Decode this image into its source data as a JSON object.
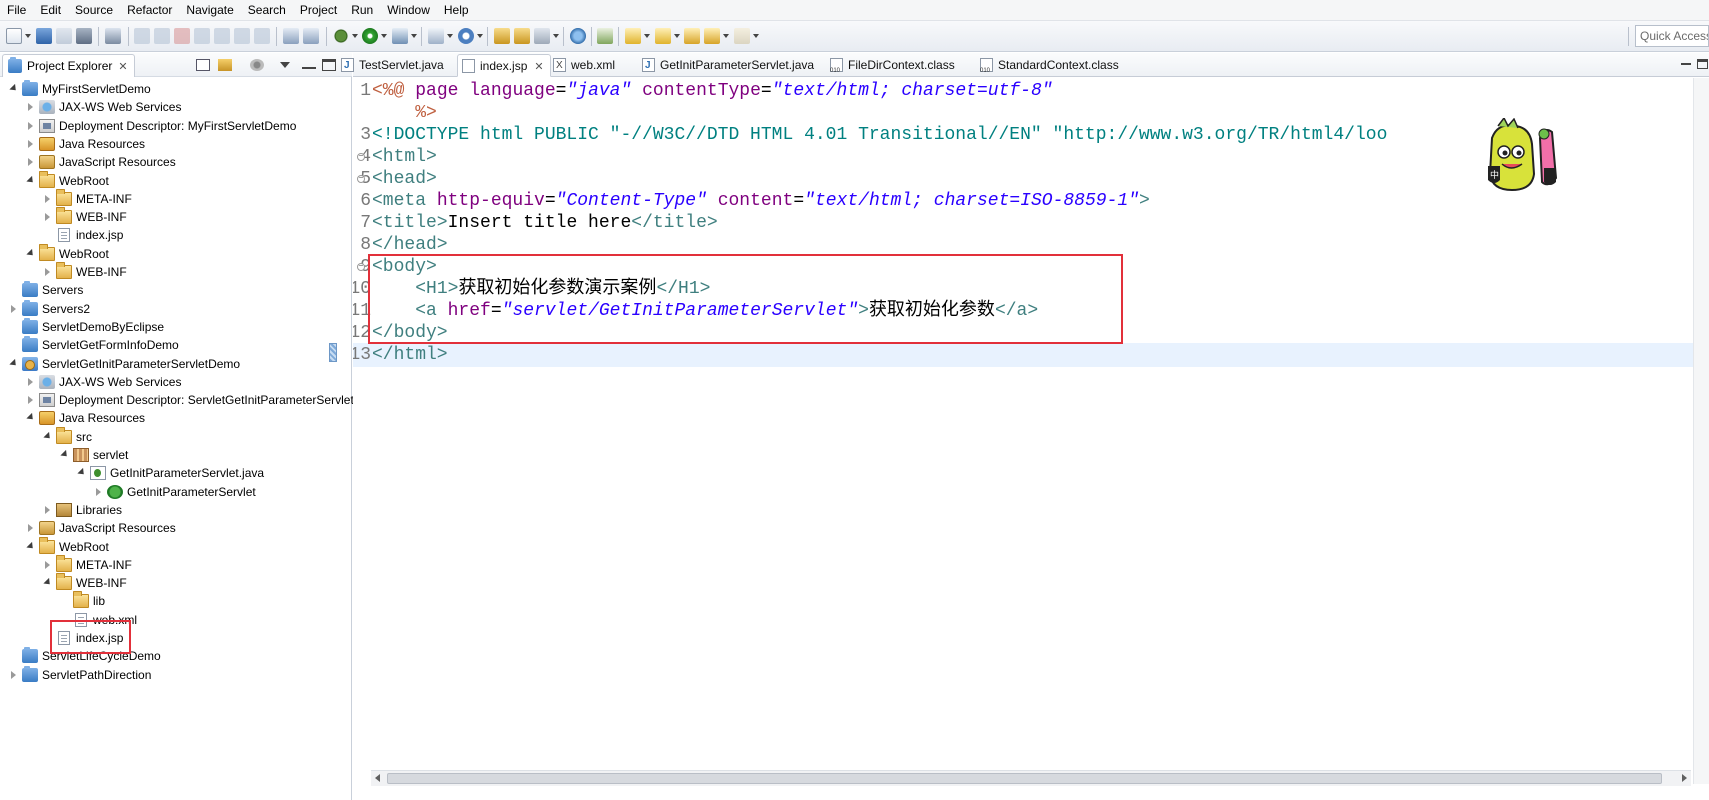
{
  "menu": [
    "File",
    "Edit",
    "Source",
    "Refactor",
    "Navigate",
    "Search",
    "Project",
    "Run",
    "Window",
    "Help"
  ],
  "quick_access": "Quick Access",
  "project_explorer": {
    "title": "Project Explorer",
    "tree": [
      {
        "label": "MyFirstServletDemo",
        "icon": "project-icon",
        "depth": 0,
        "expanded": true
      },
      {
        "label": "JAX-WS Web Services",
        "icon": "jax-ws-icon",
        "depth": 1,
        "expanded": false
      },
      {
        "label": "Deployment Descriptor: MyFirstServletDemo",
        "icon": "deployment-descriptor-icon",
        "depth": 1,
        "expanded": false
      },
      {
        "label": "Java Resources",
        "icon": "java-resources-icon",
        "depth": 1,
        "expanded": false
      },
      {
        "label": "JavaScript Resources",
        "icon": "javascript-resources-icon",
        "depth": 1,
        "expanded": false
      },
      {
        "label": "WebRoot",
        "icon": "folder-icon",
        "depth": 1,
        "expanded": true
      },
      {
        "label": "META-INF",
        "icon": "folder-icon",
        "depth": 2,
        "expanded": false
      },
      {
        "label": "WEB-INF",
        "icon": "folder-icon",
        "depth": 2,
        "expanded": false
      },
      {
        "label": "index.jsp",
        "icon": "file-icon",
        "depth": 2,
        "expanded": null
      },
      {
        "label": "WebRoot",
        "icon": "folder-icon",
        "depth": 1,
        "expanded": true
      },
      {
        "label": "WEB-INF",
        "icon": "folder-icon",
        "depth": 2,
        "expanded": false
      },
      {
        "label": "Servers",
        "icon": "project-icon",
        "depth": 0,
        "expanded": null
      },
      {
        "label": "Servers2",
        "icon": "project-icon",
        "depth": 0,
        "expanded": false
      },
      {
        "label": "ServletDemoByEclipse",
        "icon": "project-icon",
        "depth": 0,
        "expanded": null
      },
      {
        "label": "ServletGetFormInfoDemo",
        "icon": "project-icon",
        "depth": 0,
        "expanded": null
      },
      {
        "label": "ServletGetInitParameterServletDemo",
        "icon": "web-project-icon",
        "depth": 0,
        "expanded": true
      },
      {
        "label": "JAX-WS Web Services",
        "icon": "jax-ws-icon",
        "depth": 1,
        "expanded": false
      },
      {
        "label": "Deployment Descriptor: ServletGetInitParameterServletDemo",
        "icon": "deployment-descriptor-icon",
        "depth": 1,
        "expanded": false
      },
      {
        "label": "Java Resources",
        "icon": "java-resources-icon",
        "depth": 1,
        "expanded": true
      },
      {
        "label": "src",
        "icon": "source-folder-icon",
        "depth": 2,
        "expanded": true
      },
      {
        "label": "servlet",
        "icon": "package-icon",
        "depth": 3,
        "expanded": true
      },
      {
        "label": "GetInitParameterServlet.java",
        "icon": "java-file-icon",
        "depth": 4,
        "expanded": true
      },
      {
        "label": "GetInitParameterServlet",
        "icon": "class-icon",
        "depth": 5,
        "expanded": false
      },
      {
        "label": "Libraries",
        "icon": "library-icon",
        "depth": 2,
        "expanded": false
      },
      {
        "label": "JavaScript Resources",
        "icon": "javascript-resources-icon",
        "depth": 1,
        "expanded": false
      },
      {
        "label": "WebRoot",
        "icon": "folder-icon",
        "depth": 1,
        "expanded": true
      },
      {
        "label": "META-INF",
        "icon": "folder-icon",
        "depth": 2,
        "expanded": false
      },
      {
        "label": "WEB-INF",
        "icon": "folder-icon",
        "depth": 2,
        "expanded": true
      },
      {
        "label": "lib",
        "icon": "folder-icon",
        "depth": 3,
        "expanded": null
      },
      {
        "label": "web.xml",
        "icon": "xml-file-icon",
        "depth": 3,
        "expanded": null
      },
      {
        "label": "index.jsp",
        "icon": "file-icon",
        "depth": 2,
        "expanded": null
      },
      {
        "label": "ServletLifeCycleDemo",
        "icon": "project-icon",
        "depth": 0,
        "expanded": null
      },
      {
        "label": "ServletPathDirection",
        "icon": "project-icon",
        "depth": 0,
        "expanded": false
      }
    ]
  },
  "editor": {
    "tabs": [
      {
        "label": "TestServlet.java",
        "icon": "java-file-icon",
        "active": false
      },
      {
        "label": "index.jsp",
        "icon": "jsp-file-icon",
        "active": true
      },
      {
        "label": "web.xml",
        "icon": "xml-file-icon",
        "active": false
      },
      {
        "label": "GetInitParameterServlet.java",
        "icon": "java-file-icon",
        "active": false
      },
      {
        "label": "FileDirContext.class",
        "icon": "class-file-icon",
        "active": false
      },
      {
        "label": "StandardContext.class",
        "icon": "class-file-icon",
        "active": false
      }
    ],
    "lines": [
      {
        "num": "1",
        "fold": false,
        "segments": [
          [
            "dir",
            "<%@ "
          ],
          [
            "attr",
            "page "
          ],
          [
            "attr",
            "language"
          ],
          [
            "txt",
            "="
          ],
          [
            "val",
            "\"java\""
          ],
          [
            "txt",
            " "
          ],
          [
            "attr",
            "contentType"
          ],
          [
            "txt",
            "="
          ],
          [
            "val",
            "\"text/html; charset=utf-8\""
          ]
        ]
      },
      {
        "num": "",
        "fold": false,
        "segments": [
          [
            "txt",
            "    "
          ],
          [
            "dir",
            "%>"
          ]
        ]
      },
      {
        "num": "3",
        "fold": false,
        "segments": [
          [
            "doct",
            "<!DOCTYPE html PUBLIC \"-//W3C//DTD HTML 4.01 Transitional//EN\" \"http://www.w3.org/TR/html4/loo"
          ]
        ]
      },
      {
        "num": "4",
        "fold": true,
        "segments": [
          [
            "tag",
            "<html>"
          ]
        ]
      },
      {
        "num": "5",
        "fold": true,
        "segments": [
          [
            "tag",
            "<head>"
          ]
        ]
      },
      {
        "num": "6",
        "fold": false,
        "segments": [
          [
            "tag",
            "<meta "
          ],
          [
            "attr",
            "http-equiv"
          ],
          [
            "txt",
            "="
          ],
          [
            "val",
            "\"Content-Type\""
          ],
          [
            "txt",
            " "
          ],
          [
            "attr",
            "content"
          ],
          [
            "txt",
            "="
          ],
          [
            "val",
            "\"text/html; charset=ISO-8859-1\""
          ],
          [
            "tag",
            ">"
          ]
        ]
      },
      {
        "num": "7",
        "fold": false,
        "segments": [
          [
            "tag",
            "<title>"
          ],
          [
            "txt",
            "Insert title here"
          ],
          [
            "tag",
            "</title>"
          ]
        ]
      },
      {
        "num": "8",
        "fold": false,
        "segments": [
          [
            "tag",
            "</head>"
          ]
        ]
      },
      {
        "num": "9",
        "fold": true,
        "segments": [
          [
            "tag",
            "<body>"
          ]
        ]
      },
      {
        "num": "10",
        "fold": false,
        "segments": [
          [
            "txt",
            "    "
          ],
          [
            "tag",
            "<H1>"
          ],
          [
            "txt",
            "获取初始化参数演示案例"
          ],
          [
            "tag",
            "</H1>"
          ]
        ]
      },
      {
        "num": "11",
        "fold": false,
        "segments": [
          [
            "txt",
            "    "
          ],
          [
            "tag",
            "<a "
          ],
          [
            "attr",
            "href"
          ],
          [
            "txt",
            "="
          ],
          [
            "val",
            "\"servlet/GetInitParameterServlet\""
          ],
          [
            "tag",
            ">"
          ],
          [
            "txt",
            "获取初始化参数"
          ],
          [
            "tag",
            "</a>"
          ]
        ]
      },
      {
        "num": "12",
        "fold": false,
        "segments": [
          [
            "tag",
            "</body>"
          ]
        ]
      },
      {
        "num": "13",
        "fold": false,
        "segments": [
          [
            "tag",
            "</html>"
          ]
        ]
      }
    ],
    "current_line": 13
  },
  "colors": {
    "tag": "#3f7f7f",
    "attribute": "#7f007f",
    "value": "#2a00ff",
    "directive": "#bf5f3f",
    "highlight_box": "#e2303a",
    "current_line": "#e8f2fe"
  }
}
